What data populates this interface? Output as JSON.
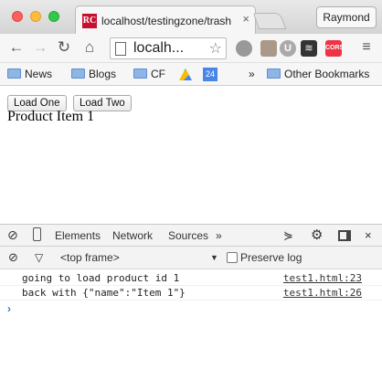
{
  "window": {
    "tab_favicon": "RC",
    "tab_title": "localhost/testingzone/trash",
    "profile_name": "Raymond"
  },
  "toolbar": {
    "address_text": "localh..."
  },
  "bookmarks": {
    "items": [
      {
        "label": "News"
      },
      {
        "label": "Blogs"
      },
      {
        "label": "CF"
      }
    ],
    "calendar_day": "24",
    "overflow": "»",
    "other": "Other Bookmarks"
  },
  "page": {
    "buttons": [
      {
        "label": "Load One"
      },
      {
        "label": "Load Two"
      }
    ],
    "product_text": "Product Item 1"
  },
  "devtools": {
    "tabs": [
      "Elements",
      "Network",
      "Sources"
    ],
    "more": "»",
    "frame_selector": "<top frame>",
    "preserve_log_label": "Preserve log",
    "console_lines": [
      {
        "message": "going to load product id 1",
        "source": "test1.html:23"
      },
      {
        "message": "back with {\"name\":\"Item 1\"}",
        "source": "test1.html:26"
      }
    ],
    "prompt_symbol": "›"
  },
  "colors": {
    "prompt": "#3879d9",
    "favicon": "#c8102e"
  }
}
